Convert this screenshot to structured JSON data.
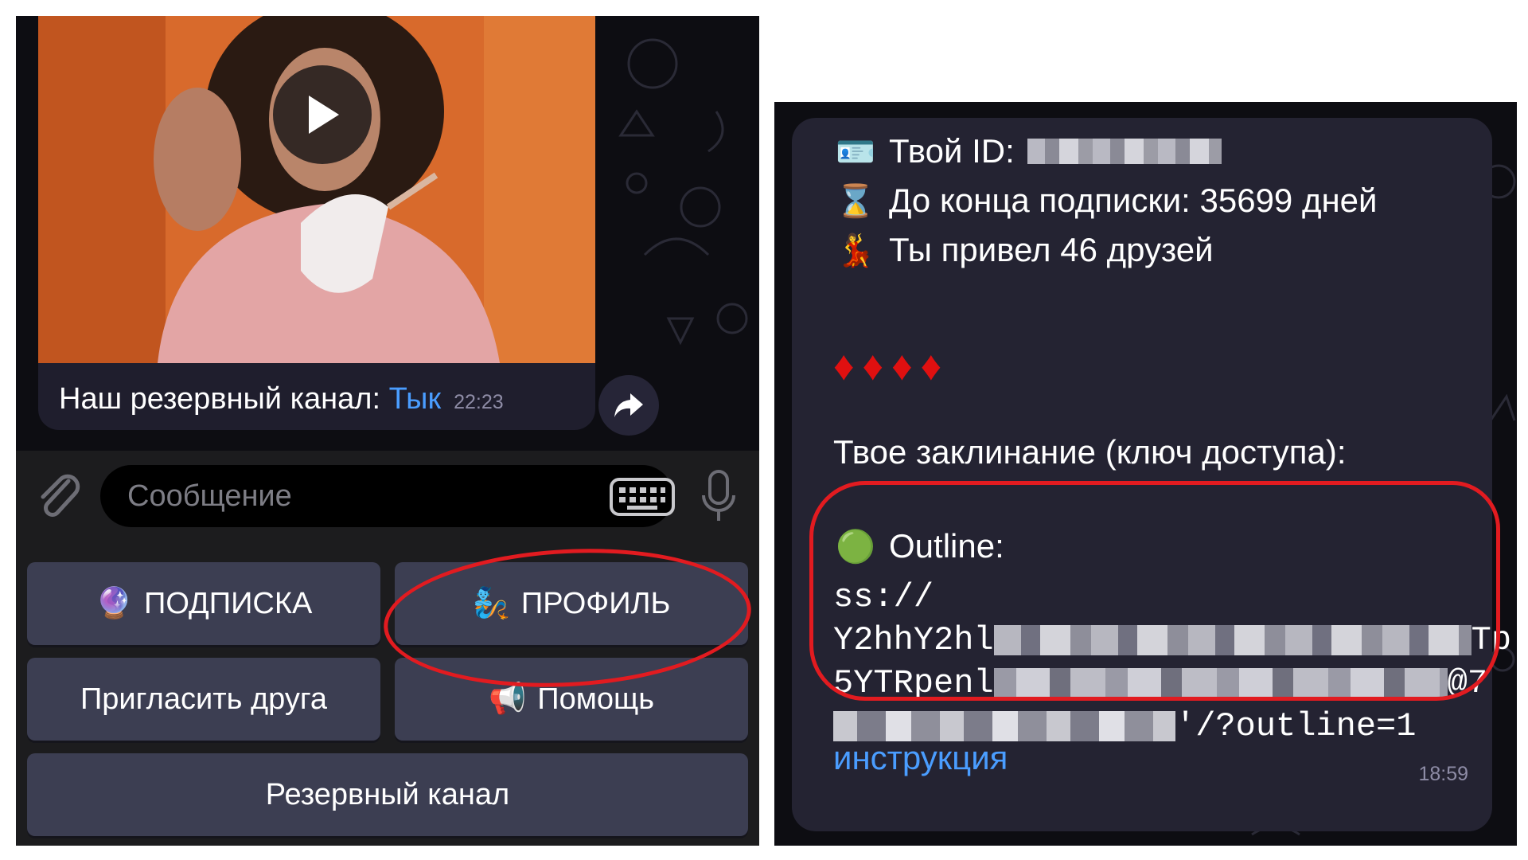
{
  "left": {
    "video": {
      "play_icon": "play-icon",
      "caption_text": "Наш резервный канал: ",
      "caption_link": "Тык",
      "time": "22:23"
    },
    "share_icon": "share-icon",
    "input": {
      "attach_icon": "paperclip-icon",
      "placeholder": "Сообщение",
      "keyboard_icon": "keyboard-icon",
      "mic_icon": "microphone-icon"
    },
    "keyboard": [
      {
        "emoji": "🔮",
        "label": "ПОДПИСКА"
      },
      {
        "emoji": "🧞",
        "label": "ПРОФИЛЬ"
      },
      {
        "emoji": "",
        "label": "Пригласить друга"
      },
      {
        "emoji": "📢",
        "label": "Помощь"
      },
      {
        "emoji": "",
        "label": "Резервный канал"
      }
    ]
  },
  "right": {
    "id_emoji": "🪪",
    "id_label": "Твой ID:",
    "sub_emoji": "⌛",
    "sub_text": "До конца подписки: 35699 дней",
    "friends_emoji": "💃",
    "friends_text": "Ты привел 46 друзей",
    "diamonds": "♦♦♦♦",
    "spell_text": "Твое заклинание (ключ доступа):",
    "outline_emoji": "🟢",
    "outline_label": "Outline:",
    "key_line1": "ss://",
    "key_line2_start": "Y2hhY2hl",
    "key_line2_end": "Tp",
    "key_line3_start": "5YTRpenl",
    "key_line3_end": "@7",
    "key_line4_end": "'/?outline=1",
    "instruction_link": "инструкция",
    "time": "18:59"
  },
  "colors": {
    "background": "#0d0d12",
    "bubble": "#242332",
    "button": "#3c3e52",
    "link": "#4a9dff",
    "annotation": "#e21b20"
  }
}
